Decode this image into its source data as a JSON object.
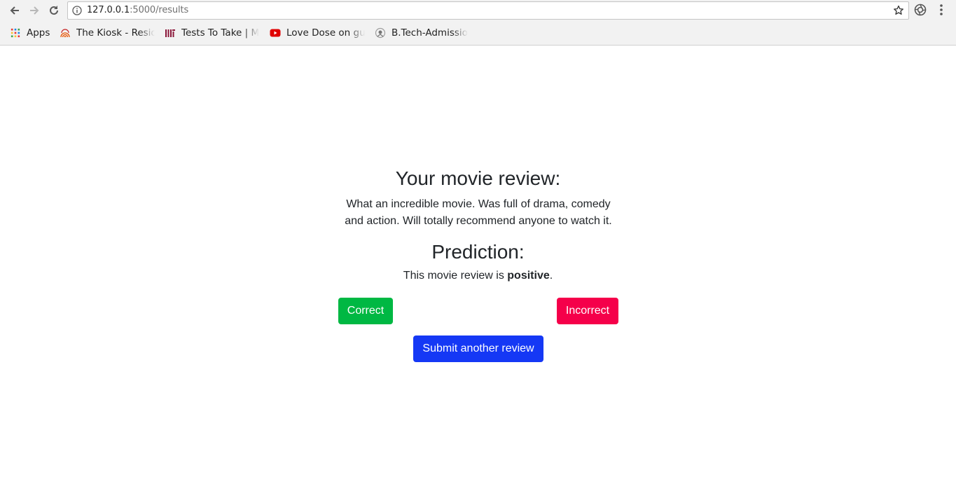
{
  "browser": {
    "url_host": "127.0.0.1",
    "url_path": ":5000/results",
    "bookmarks": [
      {
        "label": "Apps",
        "icon": "apps-grid-icon"
      },
      {
        "label": "The Kiosk - Resid",
        "icon": "fingerprint-icon"
      },
      {
        "label": "Tests To Take | M",
        "icon": "mit-logo-icon"
      },
      {
        "label": "Love Dose on gu",
        "icon": "youtube-icon"
      },
      {
        "label": "B.Tech-Admissio",
        "icon": "institute-logo-icon"
      }
    ]
  },
  "page": {
    "review_heading": "Your movie review:",
    "review_text": "What an incredible movie. Was full of drama, comedy and action. Will totally recommend anyone to watch it.",
    "prediction_heading": "Prediction:",
    "prediction_prefix": "This movie review is ",
    "prediction_value": "positive",
    "prediction_suffix": ".",
    "correct_label": "Correct",
    "incorrect_label": "Incorrect",
    "submit_label": "Submit another review"
  },
  "colors": {
    "correct": "#00b843",
    "incorrect": "#f5004a",
    "submit": "#1538f5"
  }
}
